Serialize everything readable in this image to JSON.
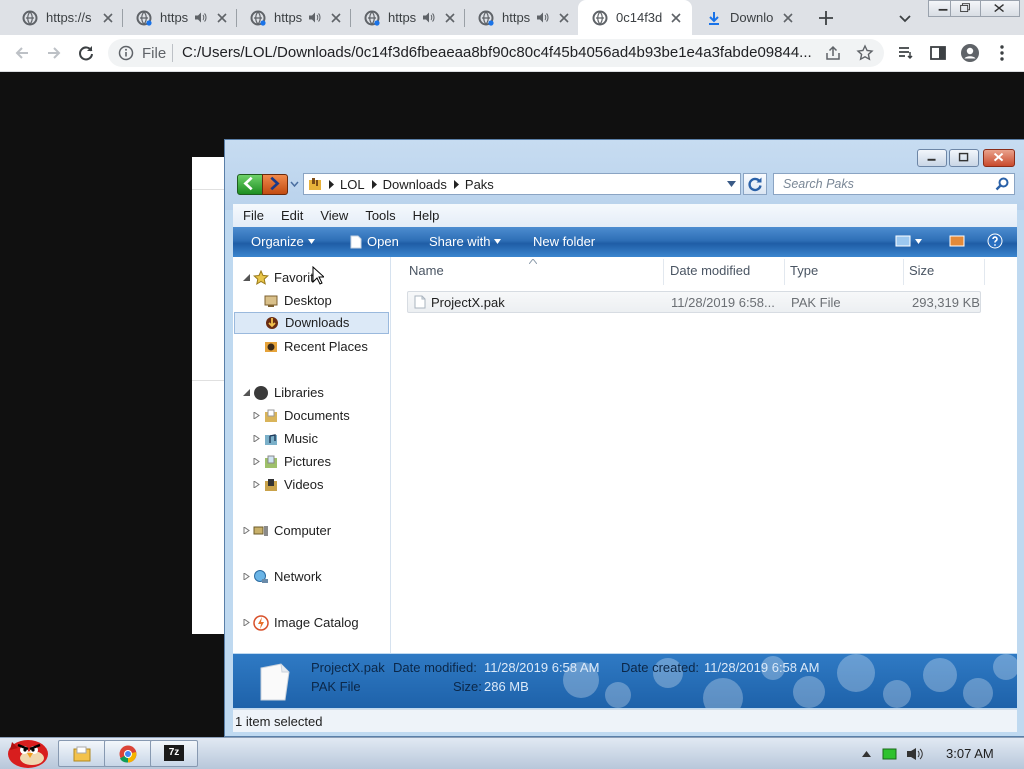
{
  "browser": {
    "tabs": [
      {
        "title": "https://s",
        "icon": "globe-icon",
        "audio": false
      },
      {
        "title": "https",
        "icon": "globe-icon",
        "audio": true
      },
      {
        "title": "https",
        "icon": "globe-icon",
        "audio": true
      },
      {
        "title": "https",
        "icon": "globe-icon",
        "audio": true
      },
      {
        "title": "https",
        "icon": "globe-icon",
        "audio": true
      },
      {
        "title": "0c14f3d",
        "icon": "globe-icon",
        "audio": false,
        "active": true
      },
      {
        "title": "Downlo",
        "icon": "download-icon",
        "audio": false
      }
    ],
    "toolbar": {
      "scheme_label": "File",
      "url": "C:/Users/LOL/Downloads/0c14f3d6fbeaeaa8bf90c80c4f45b4056ad4b93be1e4a3fabde09844..."
    }
  },
  "explorer": {
    "breadcrumb": [
      "LOL",
      "Downloads",
      "Paks"
    ],
    "search_placeholder": "Search Paks",
    "menu": [
      "File",
      "Edit",
      "View",
      "Tools",
      "Help"
    ],
    "commands": {
      "organize": "Organize",
      "open": "Open",
      "share_with": "Share with",
      "new_folder": "New folder"
    },
    "nav": {
      "favorites": {
        "label": "Favorit",
        "items": [
          "Desktop",
          "Downloads",
          "Recent Places"
        ]
      },
      "libraries": {
        "label": "Libraries",
        "items": [
          "Documents",
          "Music",
          "Pictures",
          "Videos"
        ]
      },
      "computer": "Computer",
      "network": "Network",
      "image_catalog": "Image Catalog"
    },
    "columns": [
      "Name",
      "Date modified",
      "Type",
      "Size"
    ],
    "files": [
      {
        "name": "ProjectX.pak",
        "date_modified": "11/28/2019 6:58...",
        "type": "PAK File",
        "size": "293,319 KB"
      }
    ],
    "details": {
      "name": "ProjectX.pak",
      "type": "PAK File",
      "date_modified_label": "Date modified:",
      "date_modified": "11/28/2019 6:58 AM",
      "date_created_label": "Date created:",
      "date_created": "11/28/2019 6:58 AM",
      "size_label": "Size:",
      "size": "286 MB"
    },
    "status": "1 item selected"
  },
  "taskbar": {
    "clock": "3:07 AM",
    "apps": [
      "explorer-icon",
      "chrome-icon",
      "7zip-icon"
    ],
    "seven_zip_label": "7z"
  }
}
